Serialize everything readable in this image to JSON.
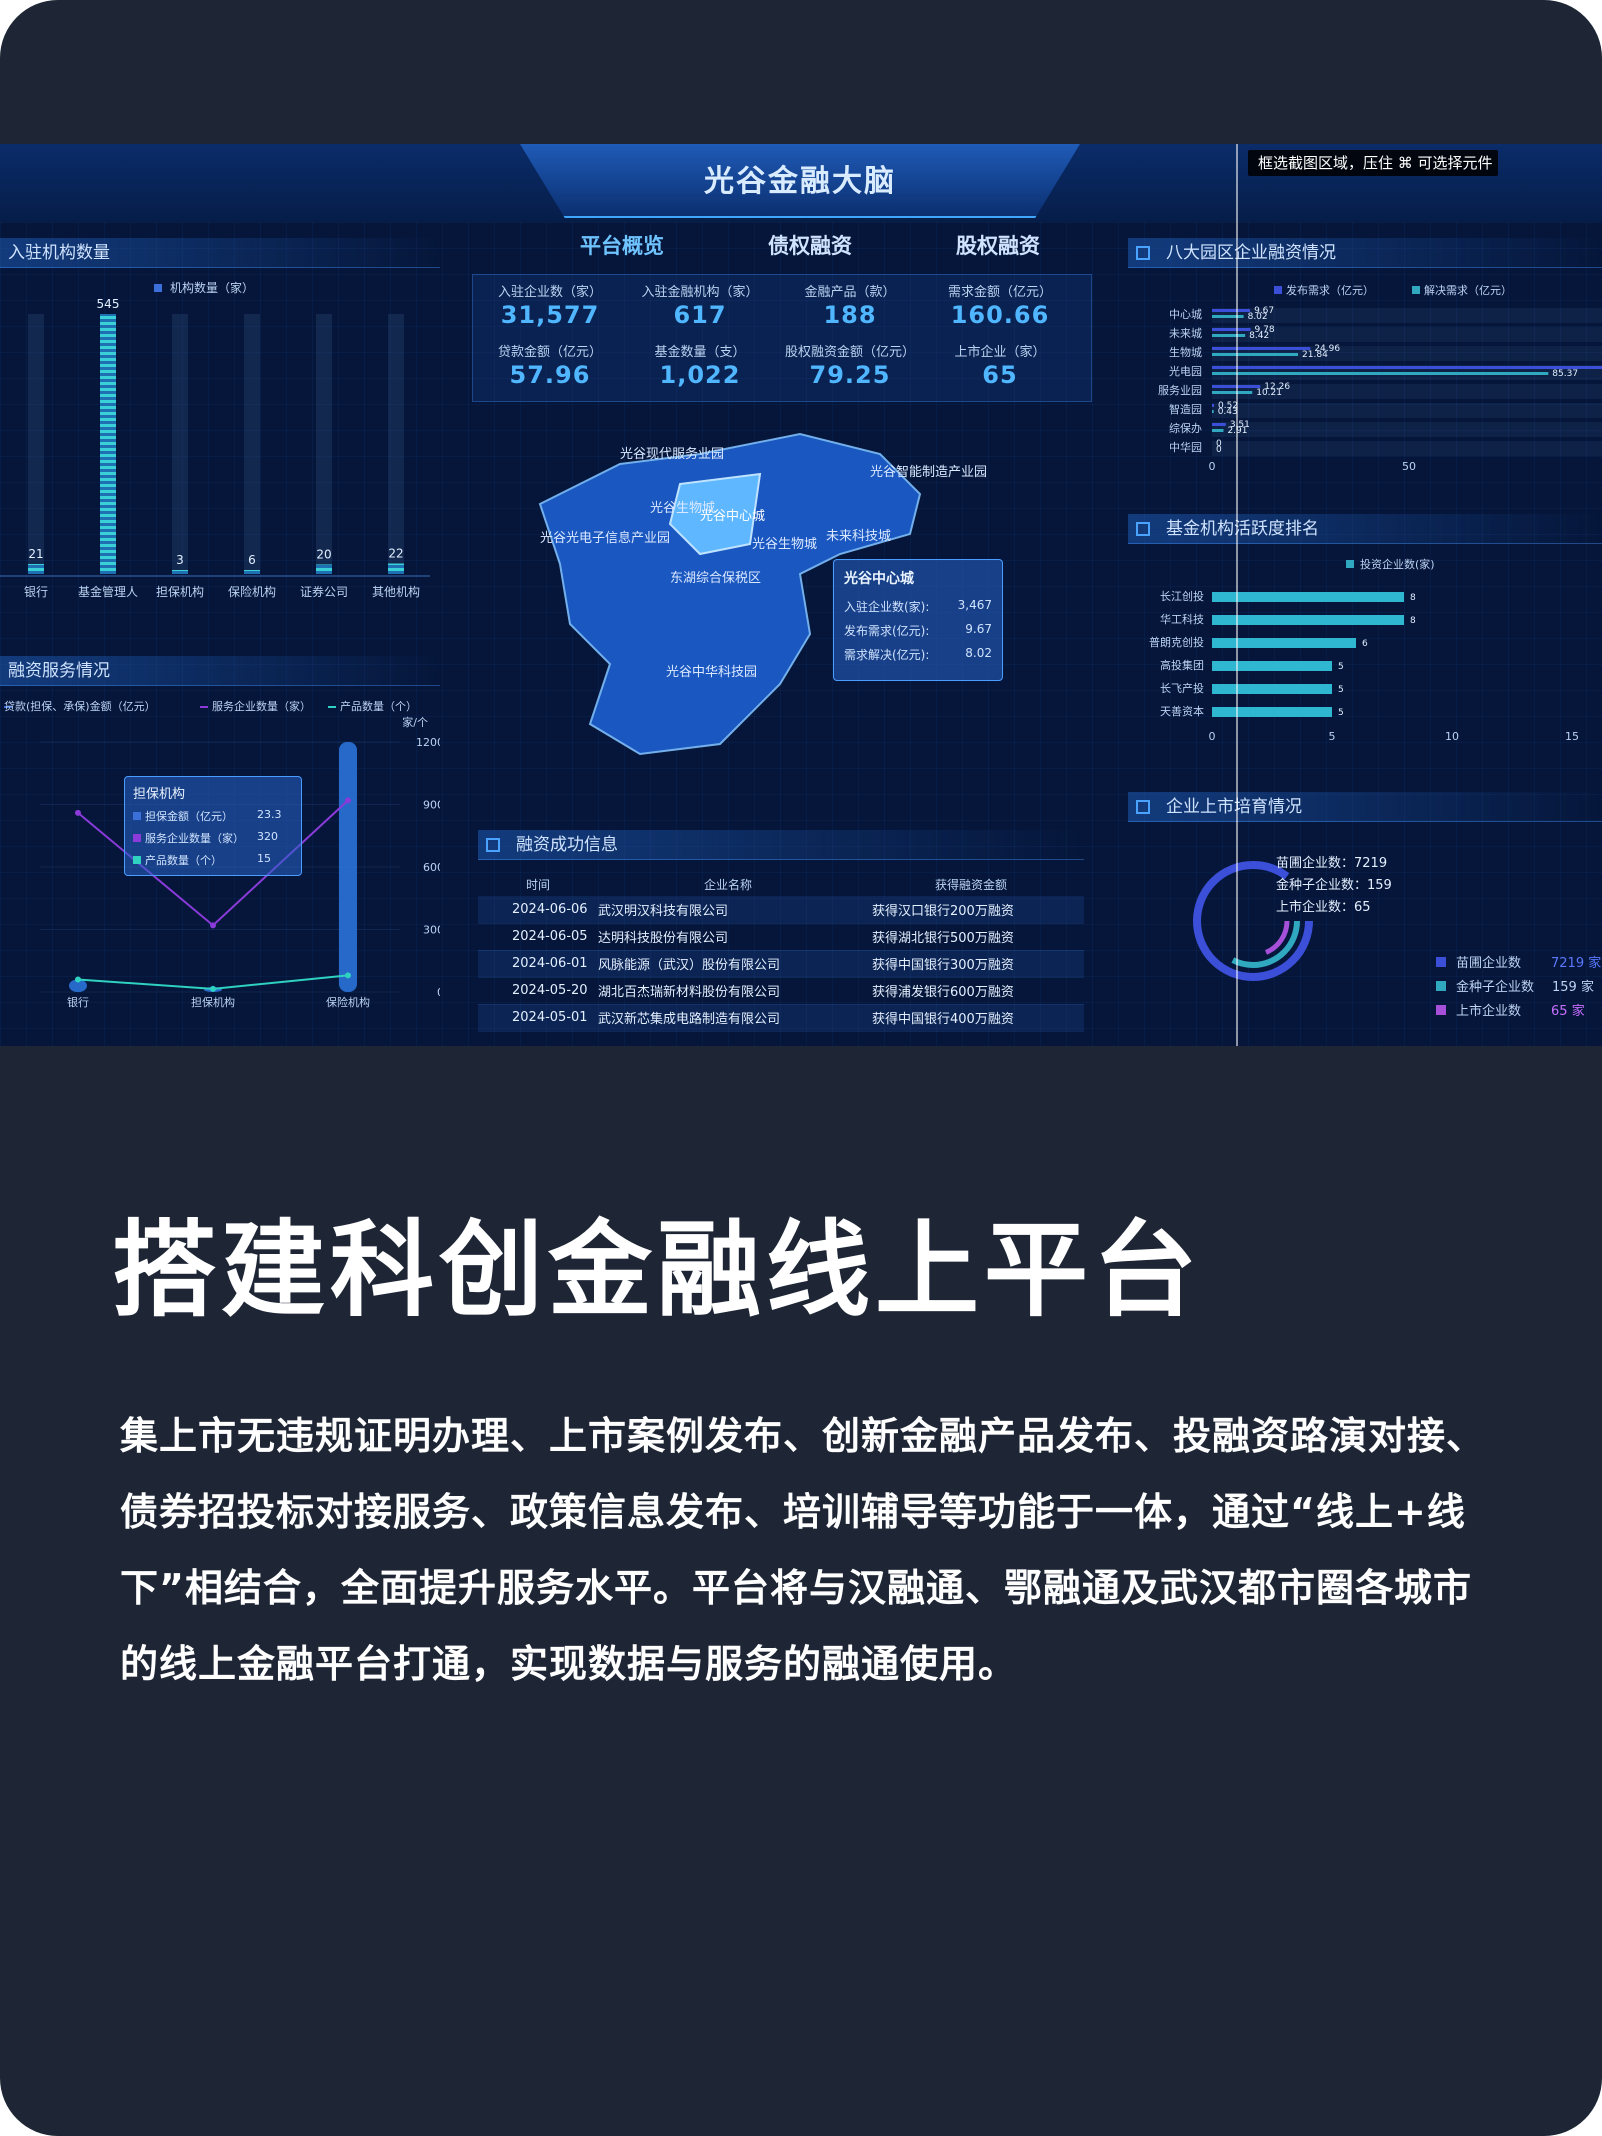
{
  "dashboard": {
    "title": "光谷金融大脑",
    "tooltip": "框选截图区域，压住 ⌘ 可选择元件",
    "tabs": [
      {
        "label": "平台概览"
      },
      {
        "label": "债权融资"
      },
      {
        "label": "股权融资"
      }
    ],
    "stats": [
      {
        "label": "入驻企业数（家）",
        "value": "31,577"
      },
      {
        "label": "入驻金融机构（家）",
        "value": "617"
      },
      {
        "label": "金融产品（款）",
        "value": "188"
      },
      {
        "label": "需求金额（亿元）",
        "value": "160.66"
      },
      {
        "label": "贷款金额（亿元）",
        "value": "57.96"
      },
      {
        "label": "基金数量（支）",
        "value": "1,022"
      },
      {
        "label": "股权融资金额（亿元）",
        "value": "79.25"
      },
      {
        "label": "上市企业（家）",
        "value": "65"
      }
    ],
    "map": {
      "regions": [
        "光谷现代服务业园",
        "光谷智能制造产业园",
        "光谷生物城",
        "光谷中心城",
        "光谷光电子信息产业园",
        "光谷生物城",
        "未来科技城",
        "东湖综合保税区",
        "光谷中华科技园"
      ],
      "tooltip": {
        "title": "光谷中心城",
        "rows": [
          {
            "label": "入驻企业数(家):",
            "value": "3,467"
          },
          {
            "label": "发布需求(亿元):",
            "value": "9.67"
          },
          {
            "label": "需求解决(亿元):",
            "value": "8.02"
          }
        ]
      }
    },
    "news": {
      "title": "融资成功信息",
      "headers": [
        "时间",
        "企业名称",
        "获得融资金额"
      ],
      "rows": [
        [
          "2024-06-06",
          "武汉明汉科技有限公司",
          "获得汉口银行200万融资"
        ],
        [
          "2024-06-05",
          "达明科技股份有限公司",
          "获得湖北银行500万融资"
        ],
        [
          "2024-06-01",
          "风脉能源（武汉）股份有限公司",
          "获得中国银行300万融资"
        ],
        [
          "2024-05-20",
          "湖北百杰瑞新材料股份有限公司",
          "获得浦发银行600万融资"
        ],
        [
          "2024-05-01",
          "武汉新芯集成电路制造有限公司",
          "获得中国银行400万融资"
        ]
      ]
    },
    "services_tooltip": {
      "title": "担保机构",
      "rows": [
        {
          "label": "担保金额（亿元）",
          "value": "23.3",
          "color": "#3b6fd9"
        },
        {
          "label": "服务企业数量（家）",
          "value": "320",
          "color": "#8a3bd9"
        },
        {
          "label": "产品数量（个）",
          "value": "15",
          "color": "#2fd1c0"
        }
      ]
    },
    "listing": {
      "title": "企业上市培育情况",
      "lines": [
        "苗圃企业数：7219",
        "金种子企业数：159",
        "上市企业数：65"
      ],
      "legend": [
        {
          "label": "苗圃企业数",
          "value": "7219 家",
          "color": "#3b4fd9"
        },
        {
          "label": "金种子企业数",
          "value": "159 家",
          "color": "#2fa8c0"
        },
        {
          "label": "上市企业数",
          "value": "65 家",
          "color": "#a64fd9"
        }
      ]
    }
  },
  "chart_data": [
    {
      "type": "bar",
      "title": "入驻机构数量",
      "legend": "机构数量（家）",
      "categories": [
        "银行",
        "基金管理人",
        "担保机构",
        "保险机构",
        "证券公司",
        "其他机构"
      ],
      "values": [
        21,
        545,
        3,
        6,
        20,
        22
      ]
    },
    {
      "type": "bar",
      "title": "融资服务情况",
      "legend": [
        "贷款(担保、承保)金额（亿元）",
        "服务企业数量（家）",
        "产品数量（个）"
      ],
      "ylabel": "家/个",
      "yticks": [
        "1200",
        "900",
        "600",
        "300",
        "0"
      ],
      "ylim": [
        0,
        1200
      ],
      "categories": [
        "银行",
        "担保机构",
        "保险机构"
      ],
      "series": [
        {
          "name": "贷款(担保、承保)金额（亿元）",
          "values": [
            60,
            23.3,
            1200
          ]
        },
        {
          "name": "服务企业数量（家）",
          "values": [
            860,
            320,
            920
          ]
        },
        {
          "name": "产品数量（个）",
          "values": [
            60,
            15,
            80
          ]
        }
      ]
    },
    {
      "type": "bar",
      "title": "八大园区企业融资情况",
      "legend": [
        "发布需求（亿元）",
        "解决需求（亿元）"
      ],
      "categories": [
        "中心城",
        "未来城",
        "生物城",
        "光电园",
        "服务业园",
        "智造园",
        "综保办",
        "中华园"
      ],
      "series": [
        {
          "name": "发布需求（亿元）",
          "values": [
            9.67,
            9.78,
            24.96,
            99,
            12.26,
            0.52,
            3.51,
            0
          ],
          "labels": [
            "9.67",
            "9.78",
            "24.96",
            "99",
            "12.26",
            "0.52",
            "3.51",
            "0"
          ]
        },
        {
          "name": "解决需求（亿元）",
          "values": [
            8.02,
            8.42,
            21.84,
            85.37,
            10.21,
            0.43,
            2.91,
            0
          ],
          "labels": [
            "8.02",
            "8.42",
            "21.84",
            "85.37",
            "10.21",
            "0.43",
            "2.91",
            "0"
          ]
        }
      ],
      "xticks": [
        "0",
        "50"
      ]
    },
    {
      "type": "bar",
      "title": "基金机构活跃度排名",
      "legend": "投资企业数(家)",
      "categories": [
        "长江创投",
        "华工科技",
        "普朗克创投",
        "高投集团",
        "长飞产投",
        "天善资本"
      ],
      "values": [
        8,
        8,
        6,
        5,
        5,
        5
      ],
      "xticks": [
        "0",
        "5",
        "10",
        "15"
      ],
      "xlim": [
        0,
        15
      ]
    }
  ],
  "page": {
    "heading": "搭建科创金融线上平台",
    "paragraph": "集上市无违规证明办理、上市案例发布、创新金融产品发布、投融资路演对接、债券招投标对接服务、政策信息发布、培训辅导等功能于一体，通过“线上+线下”相结合，全面提升服务水平。平台将与汉融通、鄂融通及武汉都市圈各城市的线上金融平台打通，实现数据与服务的融通使用。"
  },
  "colors": {
    "card": "#1e2635",
    "dash": "#05163a",
    "accent": "#4fb6ff",
    "bar_a": "#3b4fd9",
    "bar_b": "#2fa8c0"
  }
}
